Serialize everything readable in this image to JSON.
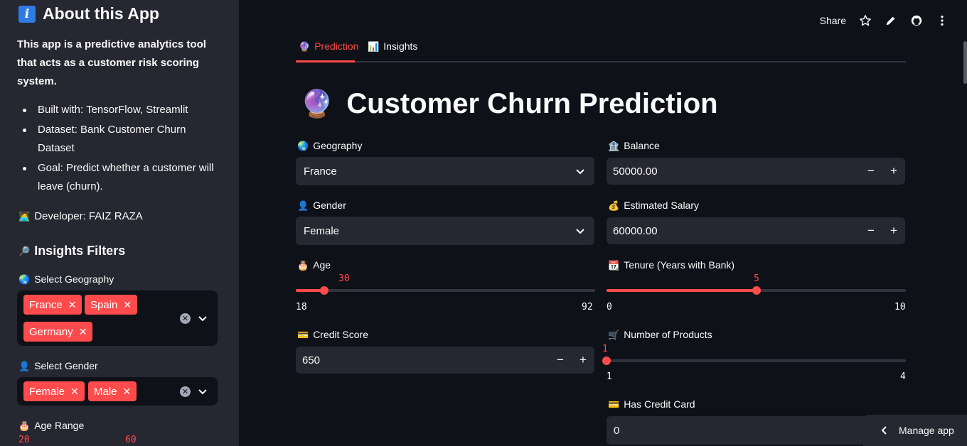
{
  "sidebar": {
    "title": "About this App",
    "description": "This app is a predictive analytics tool that acts as a customer risk scoring system.",
    "bullets": [
      "Built with: TensorFlow, Streamlit",
      "Dataset: Bank Customer Churn Dataset",
      "Goal: Predict whether a customer will leave (churn)."
    ],
    "developer": "Developer: FAIZ RAZA",
    "filters_title": "Insights Filters",
    "geo_label": "Select Geography",
    "geo_chips": [
      "France",
      "Spain",
      "Germany"
    ],
    "gender_label": "Select Gender",
    "gender_chips": [
      "Female",
      "Male"
    ],
    "age_label": "Age Range",
    "age_min": "20",
    "age_max": "60"
  },
  "topbar": {
    "share": "Share",
    "icons": [
      "star-icon",
      "pencil-icon",
      "github-icon",
      "more-vertical-icon"
    ]
  },
  "tabs": [
    {
      "label": "Prediction",
      "icon": "crystal-ball-icon",
      "active": true
    },
    {
      "label": "Insights",
      "icon": "bar-chart-icon",
      "active": false
    }
  ],
  "page_title": "Customer Churn Prediction",
  "form": {
    "geography": {
      "label": "Geography",
      "value": "France"
    },
    "gender": {
      "label": "Gender",
      "value": "Female"
    },
    "age": {
      "label": "Age",
      "value": "30",
      "min": "18",
      "max": "92",
      "fraction": 0.0946
    },
    "credit_score": {
      "label": "Credit Score",
      "value": "650"
    },
    "balance": {
      "label": "Balance",
      "value": "50000.00"
    },
    "salary": {
      "label": "Estimated Salary",
      "value": "60000.00"
    },
    "tenure": {
      "label": "Tenure (Years with Bank)",
      "value": "5",
      "min": "0",
      "max": "10",
      "fraction": 0.5
    },
    "products": {
      "label": "Number of Products",
      "value": "1",
      "min": "1",
      "max": "4",
      "fraction": 0
    },
    "credit_card": {
      "label": "Has Credit Card",
      "value": "0"
    }
  },
  "manage": "Manage app",
  "colors": {
    "accent": "#ff4b4b",
    "bg": "#0e1117",
    "panel": "#262730"
  }
}
